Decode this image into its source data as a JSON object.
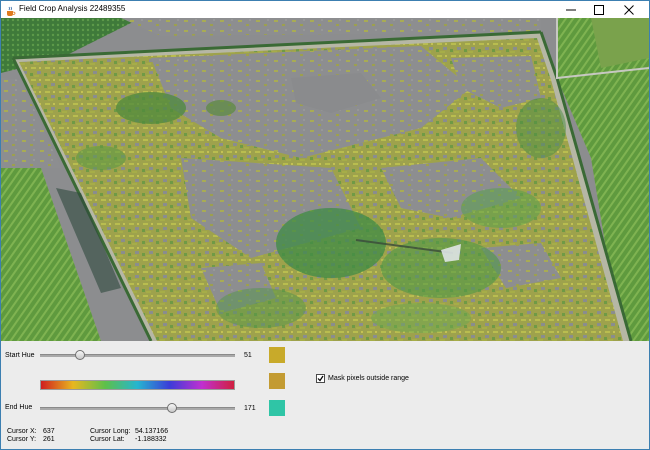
{
  "window": {
    "title": "Field Crop Analysis 22489355"
  },
  "controls": {
    "start_hue": {
      "label": "Start Hue",
      "value": "51",
      "fraction": 0.2
    },
    "end_hue": {
      "label": "End Hue",
      "value": "171",
      "fraction": 0.67
    },
    "swatches": {
      "start_color": "#c8aa2a",
      "mid_color": "#c39b32",
      "end_color": "#2fc5a6"
    },
    "mask_checkbox": {
      "label": "Mask pixels outside range",
      "checked": true
    },
    "hue_gradient": [
      "#d01f1f",
      "#e8b720",
      "#5dc04a",
      "#26b5d0",
      "#3c3cd8",
      "#c030d0",
      "#d02040"
    ]
  },
  "cursor": {
    "x_label": "Cursor X:",
    "x_value": "637",
    "y_label": "Cursor Y:",
    "y_value": "261",
    "long_label": "Cursor Long:",
    "long_value": "54.137166",
    "lat_label": "Cursor Lat:",
    "lat_value": "-1.188332"
  },
  "colors": {
    "crop_yellow": "#b4b845",
    "crop_green": "#4e8a3c",
    "masked_gray": "#8c8d8f"
  },
  "icons": {
    "app": "java-cup-icon",
    "minimize": "minimize-icon",
    "maximize": "maximize-icon",
    "close": "close-icon"
  }
}
